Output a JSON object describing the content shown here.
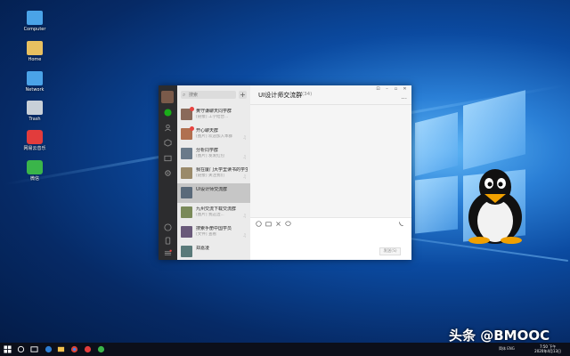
{
  "desktop": {
    "icons": [
      {
        "label": "Computer",
        "icon": "computer-icon",
        "color": "#4aa3e8"
      },
      {
        "label": "Home",
        "icon": "folder-icon",
        "color": "#e8c060"
      },
      {
        "label": "Network",
        "icon": "network-icon",
        "color": "#4aa3e8"
      },
      {
        "label": "Trash",
        "icon": "trash-icon",
        "color": "#c8d0d8"
      },
      {
        "label": "网易云音乐",
        "icon": "netease-music-icon",
        "color": "#e23c3c"
      },
      {
        "label": "微信",
        "icon": "wechat-icon",
        "color": "#3ab54a"
      }
    ]
  },
  "app": {
    "search": {
      "placeholder": "搜索"
    },
    "add_label": "+",
    "chats": [
      {
        "name": "黄守谦聊天同学群",
        "preview": "[链接] 工学结合...",
        "time": "",
        "unread": true,
        "mute": false,
        "thumb_color": "#8a6a5a"
      },
      {
        "name": "开心聊天群",
        "preview": "[图片] 欢迎加入本群",
        "time": "",
        "unread": true,
        "mute": true,
        "thumb_color": "#b07050"
      },
      {
        "name": "分析同学群",
        "preview": "[图片] 发发红包",
        "time": "",
        "unread": false,
        "mute": true,
        "thumb_color": "#6a7a8a"
      },
      {
        "name": "我在厦门大学里读书的学生",
        "preview": "[链接] 关注我们",
        "time": "",
        "unread": false,
        "mute": true,
        "thumb_color": "#9a8a6a"
      },
      {
        "name": "UI设计师交流群",
        "preview": "",
        "time": "",
        "unread": false,
        "mute": false,
        "thumb_color": "#5a6a7a",
        "active": true
      },
      {
        "name": "九州交流下载交流群",
        "preview": "[图片] 我这边...",
        "time": "",
        "unread": false,
        "mute": true,
        "thumb_color": "#7a8a5a"
      },
      {
        "name": "搜索手册中国学员",
        "preview": "[文件] 查看",
        "time": "",
        "unread": false,
        "mute": true,
        "thumb_color": "#6a5a7a"
      },
      {
        "name": "郑嘉凌",
        "preview": "",
        "time": "",
        "unread": false,
        "mute": false,
        "thumb_color": "#5a7a7a"
      }
    ],
    "conversation": {
      "title": "UI设计师交流群",
      "member_count": "(34)",
      "more_label": "···",
      "send_label": "发送(S)"
    },
    "window_controls": [
      "⊡",
      "–",
      "▫",
      "✕"
    ]
  },
  "taskbar": {
    "tray_text": "简体 ENG",
    "time": "7:50 下午",
    "date": "2020年4月13日"
  },
  "watermark": "头条 @BMOOC"
}
